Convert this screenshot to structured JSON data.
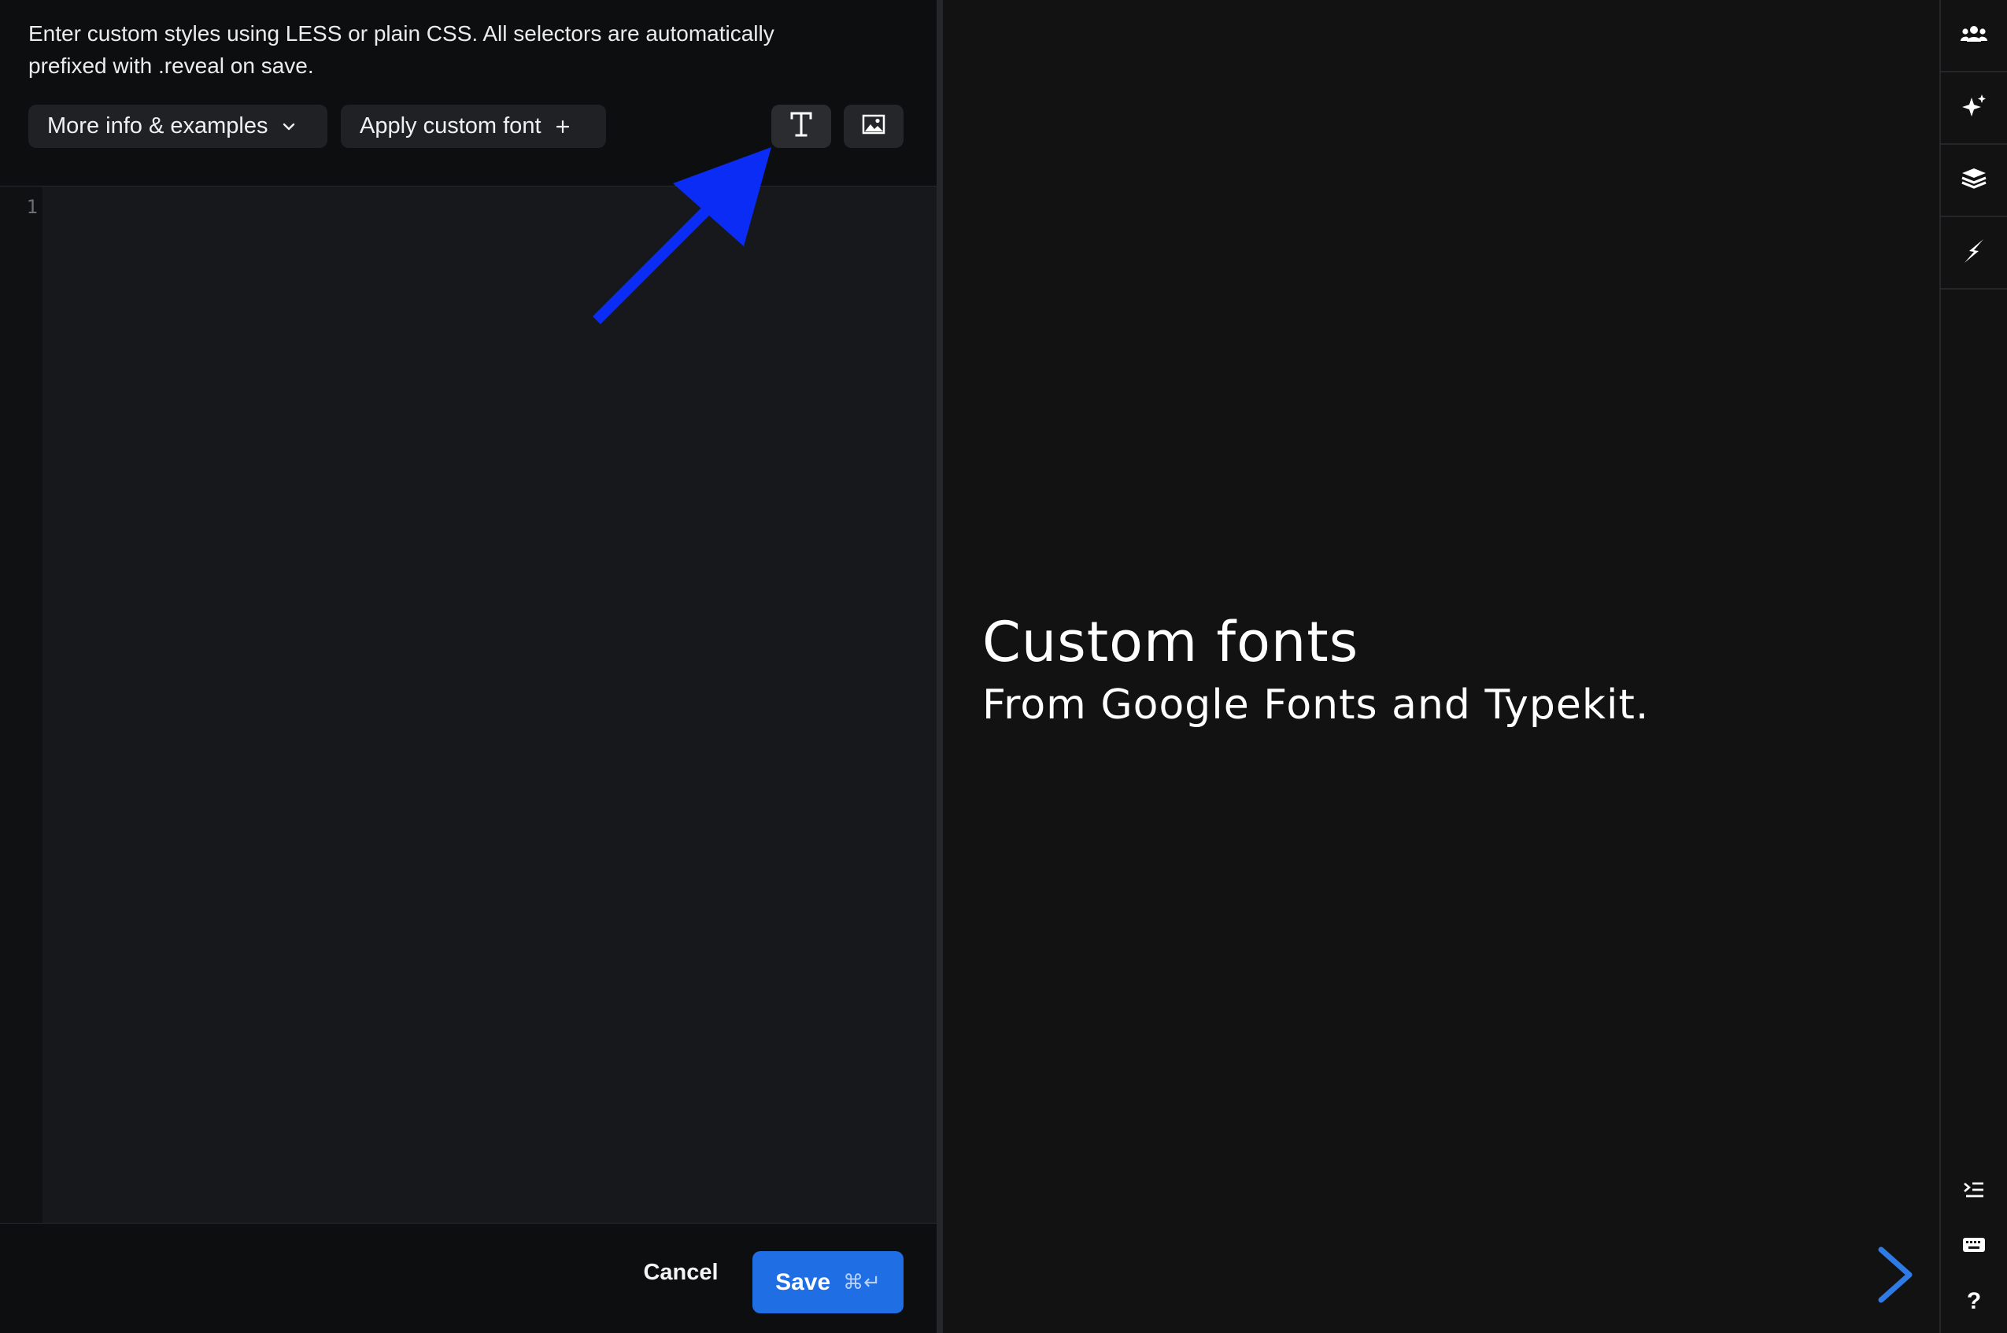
{
  "editor": {
    "description": "Enter custom styles using LESS or plain CSS. All selectors are automatically prefixed with .reveal on save.",
    "more_info_label": "More info & examples",
    "apply_font_label": "Apply custom font",
    "font_button_icon": "text-font-icon",
    "image_button_icon": "image-icon",
    "line_numbers": [
      "1"
    ],
    "annotation_color": "#0a2cf5"
  },
  "footer": {
    "cancel_label": "Cancel",
    "save_label": "Save",
    "save_shortcut": "⌘↵",
    "save_color": "#1f6ee4"
  },
  "preview": {
    "title": "Custom fonts",
    "subtitle": "From Google Fonts and Typekit.",
    "next_icon": "chevron-right-icon",
    "accent": "#2f7be6"
  },
  "toolbar": {
    "top_tools": [
      "users-icon",
      "sparkle-icon",
      "layers-icon",
      "lightning-icon"
    ],
    "bottom_tools": [
      "outline-list-icon",
      "keyboard-icon",
      "help-icon"
    ],
    "help_glyph": "?"
  }
}
